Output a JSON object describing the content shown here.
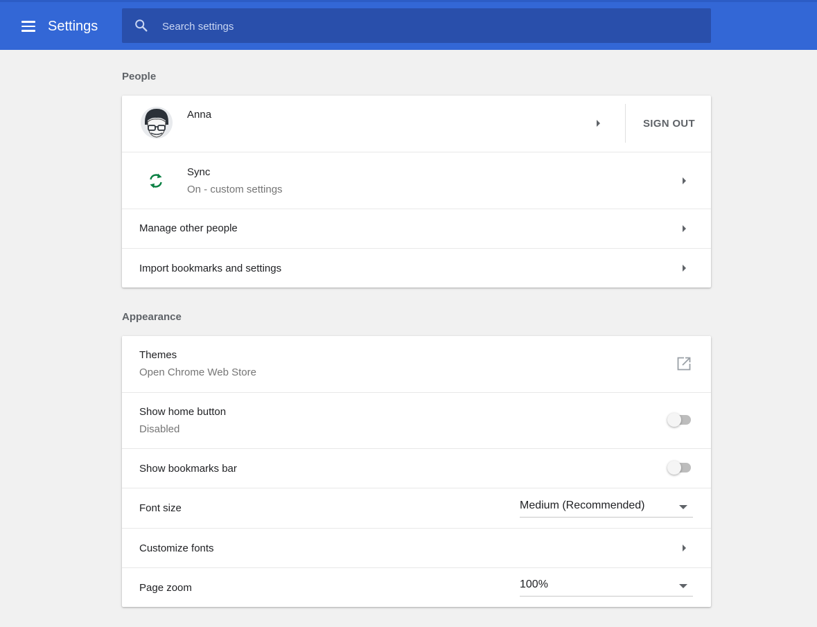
{
  "header": {
    "title": "Settings",
    "search_placeholder": "Search settings",
    "menu_icon": "hamburger-menu-icon",
    "search_icon": "search-icon",
    "background_color": "#3367d6"
  },
  "people": {
    "section_title": "People",
    "profile": {
      "name": "Anna",
      "sign_out_label": "SIGN OUT",
      "avatar_icon": "avatar-icon"
    },
    "sync": {
      "label": "Sync",
      "status": "On - custom settings",
      "icon": "sync-icon",
      "icon_color": "#0b8043"
    },
    "manage_label": "Manage other people",
    "import_label": "Import bookmarks and settings"
  },
  "appearance": {
    "section_title": "Appearance",
    "themes": {
      "label": "Themes",
      "sub": "Open Chrome Web Store",
      "icon": "open-in-new-icon"
    },
    "home_button": {
      "label": "Show home button",
      "sub": "Disabled",
      "enabled": false
    },
    "bookmarks_bar": {
      "label": "Show bookmarks bar",
      "enabled": false
    },
    "font_size": {
      "label": "Font size",
      "value": "Medium (Recommended)"
    },
    "customize_fonts": {
      "label": "Customize fonts"
    },
    "page_zoom": {
      "label": "Page zoom",
      "value": "100%"
    }
  }
}
